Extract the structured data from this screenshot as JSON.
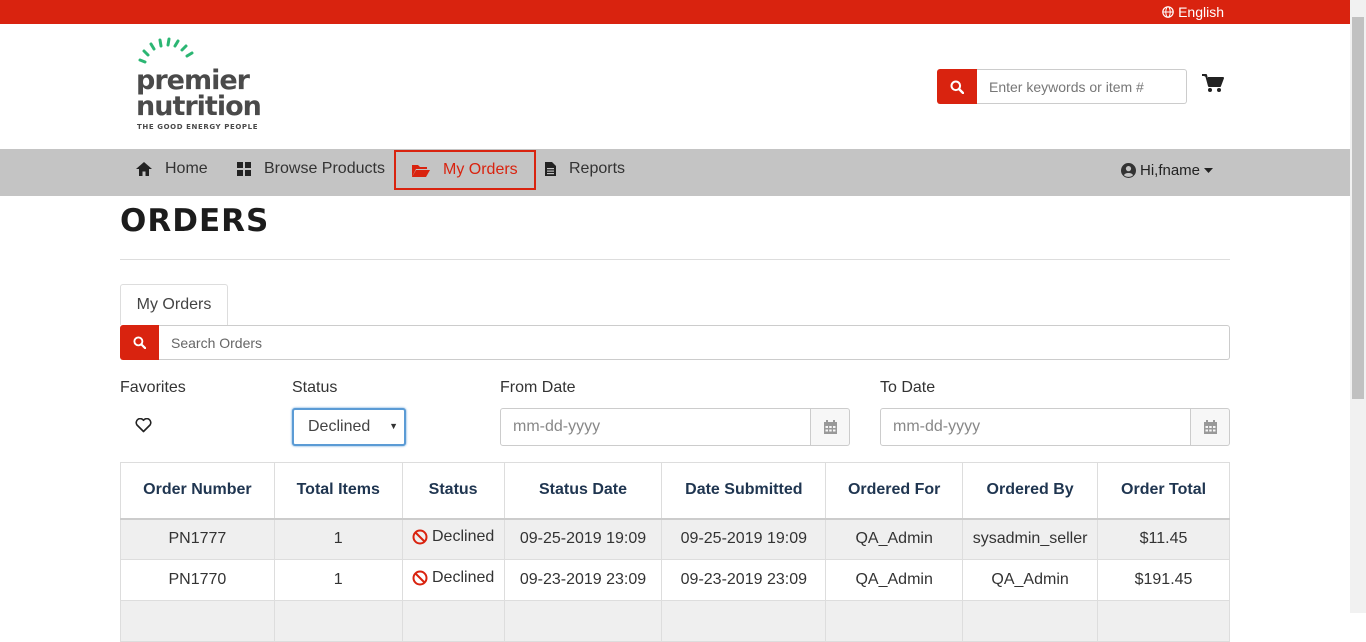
{
  "topbar": {
    "language": "English"
  },
  "logo": {
    "line1": "premier",
    "line2": "nutrition",
    "tagline": "THE GOOD ENERGY PEOPLE"
  },
  "search": {
    "placeholder": "Enter keywords or item #"
  },
  "nav": {
    "items": [
      {
        "label": "Home",
        "icon": "home-icon"
      },
      {
        "label": "Browse Products",
        "icon": "grid-icon"
      },
      {
        "label": "My Orders",
        "icon": "folder-open-icon",
        "active": true
      },
      {
        "label": "Reports",
        "icon": "file-icon"
      }
    ],
    "user_greeting": "Hi,fname"
  },
  "page": {
    "title": "ORDERS"
  },
  "tabs": [
    {
      "label": "My Orders"
    }
  ],
  "order_search": {
    "placeholder": "Search Orders"
  },
  "filters": {
    "favorites_label": "Favorites",
    "status_label": "Status",
    "status_value": "Declined",
    "from_label": "From Date",
    "from_placeholder": "mm-dd-yyyy",
    "to_label": "To Date",
    "to_placeholder": "mm-dd-yyyy"
  },
  "table": {
    "headers": [
      "Order Number",
      "Total Items",
      "Status",
      "Status Date",
      "Date Submitted",
      "Ordered For",
      "Ordered By",
      "Order Total"
    ],
    "rows": [
      {
        "order_number": "PN1777",
        "total_items": "1",
        "status": "Declined",
        "status_date": "09-25-2019 19:09",
        "date_submitted": "09-25-2019 19:09",
        "ordered_for": "QA_Admin",
        "ordered_by": "sysadmin_seller",
        "order_total": "$11.45"
      },
      {
        "order_number": "PN1770",
        "total_items": "1",
        "status": "Declined",
        "status_date": "09-23-2019 23:09",
        "date_submitted": "09-23-2019 23:09",
        "ordered_for": "QA_Admin",
        "ordered_by": "QA_Admin",
        "order_total": "$191.45"
      }
    ]
  },
  "colors": {
    "brand_red": "#d9230f",
    "nav_gray": "#c4c4c4",
    "logo_green": "#2bb673",
    "header_text": "#1f3550"
  }
}
